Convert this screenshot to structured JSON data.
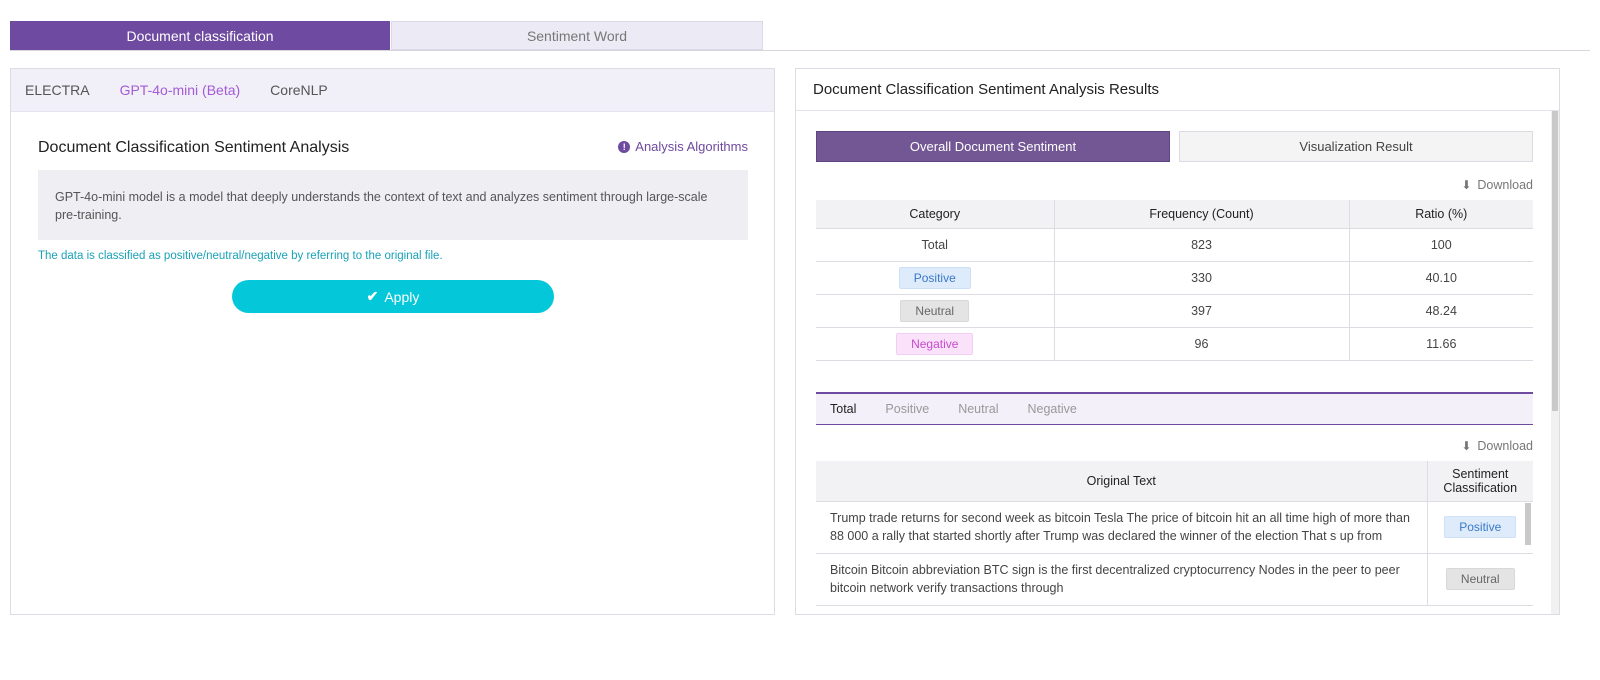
{
  "top_tabs": {
    "active": "Document classification",
    "inactive": "Sentiment Word"
  },
  "left": {
    "models": [
      "ELECTRA",
      "GPT-4o-mini (Beta)",
      "CoreNLP"
    ],
    "active_model": "GPT-4o-mini (Beta)",
    "title": "Document Classification Sentiment Analysis",
    "algo_link": "Analysis Algorithms",
    "description": "GPT-4o-mini model is a model that deeply understands the context of text and analyzes sentiment through large-scale pre-training.",
    "note": "The data is classified as positive/neutral/negative by referring to the original file.",
    "apply_label": "Apply"
  },
  "right": {
    "title": "Document Classification Sentiment Analysis Results",
    "tabs": {
      "active": "Overall Document Sentiment",
      "inactive": "Visualization Result"
    },
    "download_label": "Download",
    "summary": {
      "headers": [
        "Category",
        "Frequency (Count)",
        "Ratio (%)"
      ],
      "rows": [
        {
          "category": "Total",
          "count": "823",
          "ratio": "100"
        },
        {
          "category": "Positive",
          "count": "330",
          "ratio": "40.10"
        },
        {
          "category": "Neutral",
          "count": "397",
          "ratio": "48.24"
        },
        {
          "category": "Negative",
          "count": "96",
          "ratio": "11.66"
        }
      ]
    },
    "filters": [
      "Total",
      "Positive",
      "Neutral",
      "Negative"
    ],
    "active_filter": "Total",
    "text_table": {
      "headers": [
        "Original Text",
        "Sentiment Classification"
      ],
      "rows": [
        {
          "text": "Trump trade returns for second week as bitcoin Tesla The price of bitcoin hit an all time high of more than 88 000 a rally that started shortly after Trump was declared the winner of the election That s up from",
          "label": "Positive"
        },
        {
          "text": "Bitcoin Bitcoin abbreviation BTC sign is the first decentralized cryptocurrency Nodes in the peer to peer bitcoin network verify transactions through",
          "label": "Neutral"
        }
      ]
    }
  },
  "colors": {
    "primary_purple": "#6e4aa0",
    "apply_cyan": "#04c8d9",
    "positive": "#3a78c8",
    "negative": "#c64ccc"
  }
}
